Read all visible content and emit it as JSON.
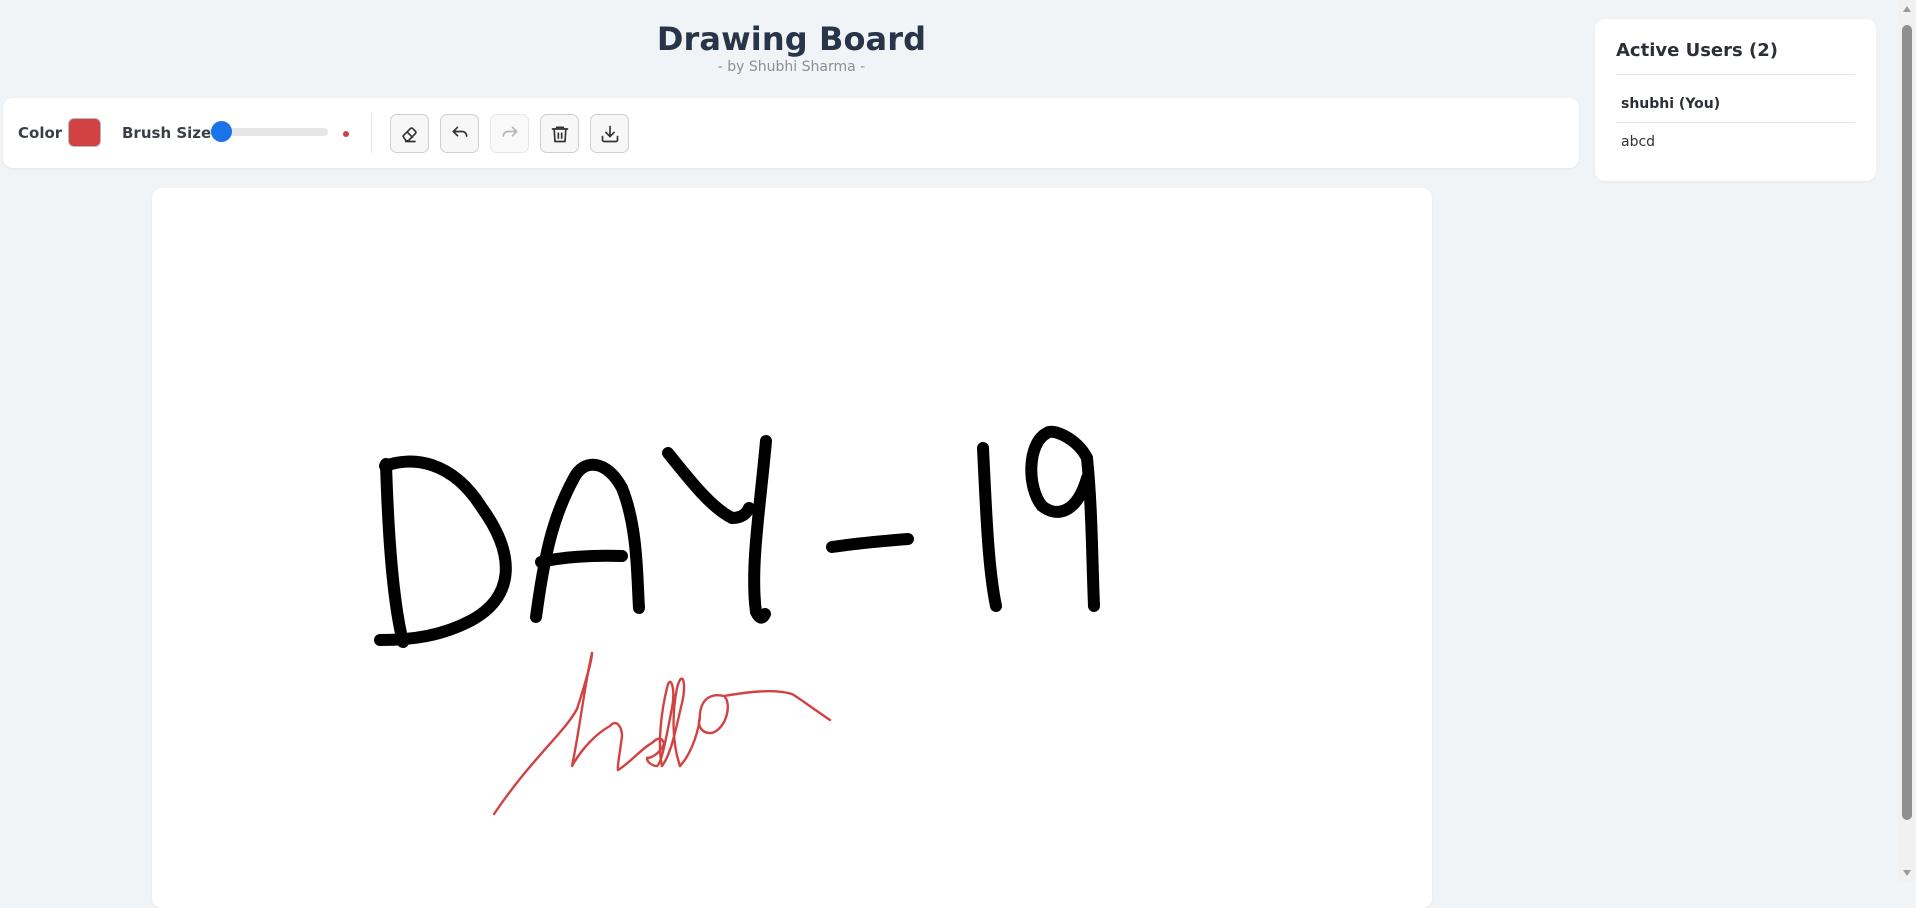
{
  "header": {
    "title": "Drawing Board",
    "subtitle": "- by Shubhi Sharma -"
  },
  "toolbar": {
    "color_label": "Color",
    "color_value": "#d14343",
    "brush_size_label": "Brush Size",
    "brush_size_fraction": 0.1,
    "slider_accent": "#1a73e8",
    "buttons": [
      {
        "name": "eraser-button",
        "icon": "eraser-icon",
        "enabled": true
      },
      {
        "name": "undo-button",
        "icon": "undo-icon",
        "enabled": true
      },
      {
        "name": "redo-button",
        "icon": "redo-icon",
        "enabled": false
      },
      {
        "name": "clear-button",
        "icon": "trash-icon",
        "enabled": true
      },
      {
        "name": "download-button",
        "icon": "download-icon",
        "enabled": true
      }
    ]
  },
  "users": {
    "title": "Active Users (2)",
    "list": [
      {
        "label": "shubhi (You)",
        "is_self": true
      },
      {
        "label": "abcd",
        "is_self": false
      }
    ]
  },
  "canvas": {
    "background": "#ffffff",
    "strokes": [
      {
        "name": "stroke-day-19",
        "text": "DAY-19",
        "color": "#000000"
      },
      {
        "name": "stroke-hello",
        "text": "hello",
        "color": "#d14343"
      }
    ]
  }
}
